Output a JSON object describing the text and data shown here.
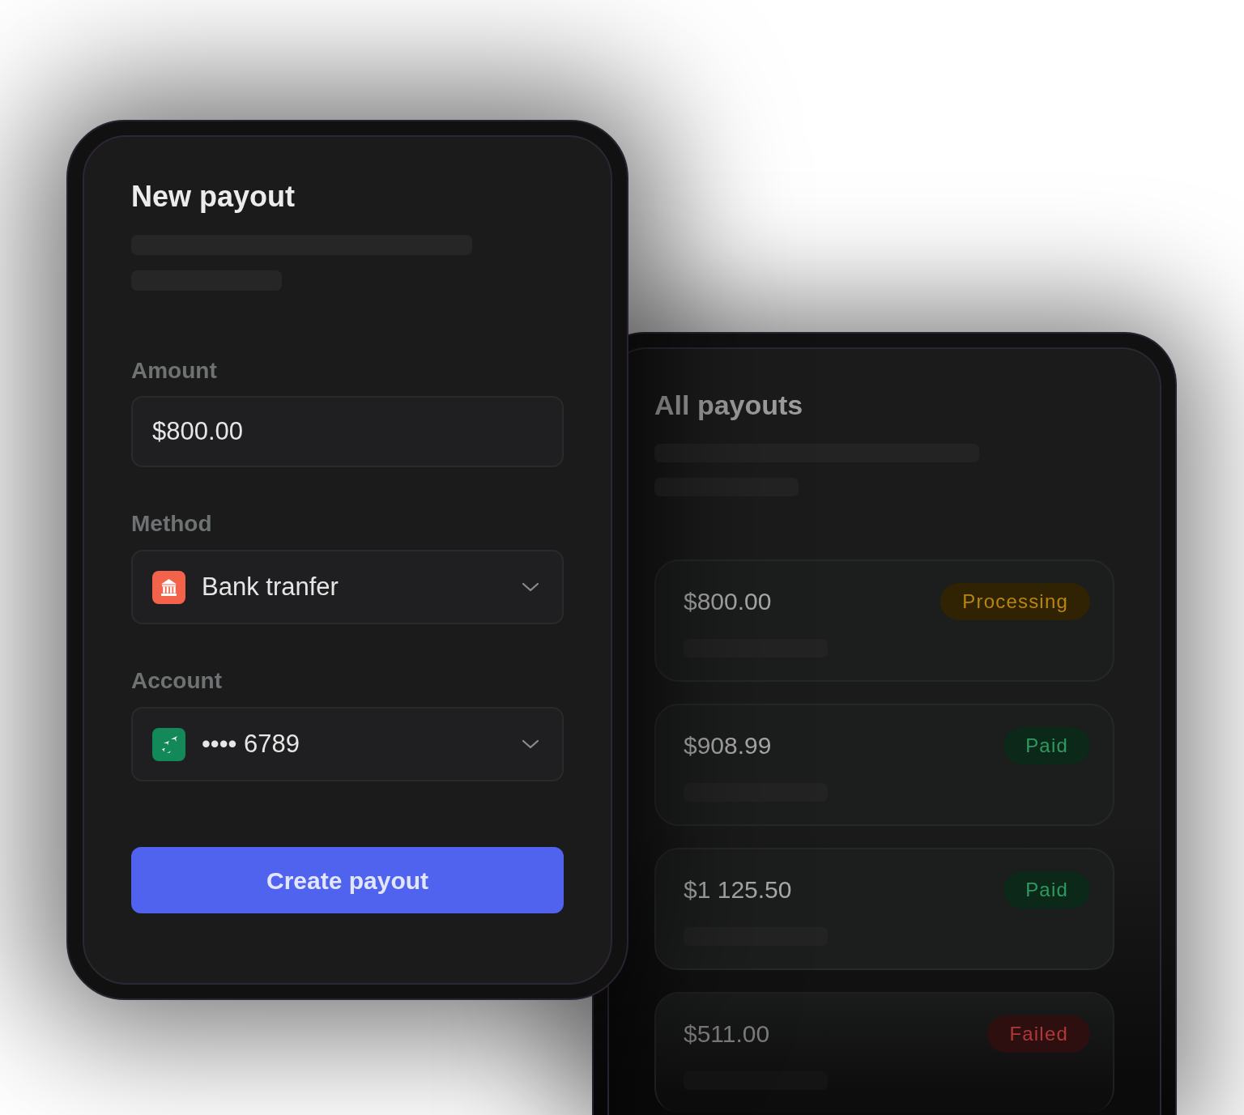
{
  "new_payout": {
    "title": "New payout",
    "amount": {
      "label": "Amount",
      "value": "$800.00"
    },
    "method": {
      "label": "Method",
      "value": "Bank tranfer"
    },
    "account": {
      "label": "Account",
      "value": "•••• 6789"
    },
    "button": "Create payout"
  },
  "all_payouts": {
    "title": "All payouts",
    "payouts": [
      {
        "amount": "$800.00",
        "status": "Processing",
        "color": "#b8860f"
      },
      {
        "amount": "$908.99",
        "status": "Paid",
        "color": "#2e9a60"
      },
      {
        "amount": "$1 125.50",
        "status": "Paid",
        "color": "#2e9a60"
      },
      {
        "amount": "$511.00",
        "status": "Failed",
        "color": "#b03838"
      }
    ]
  }
}
